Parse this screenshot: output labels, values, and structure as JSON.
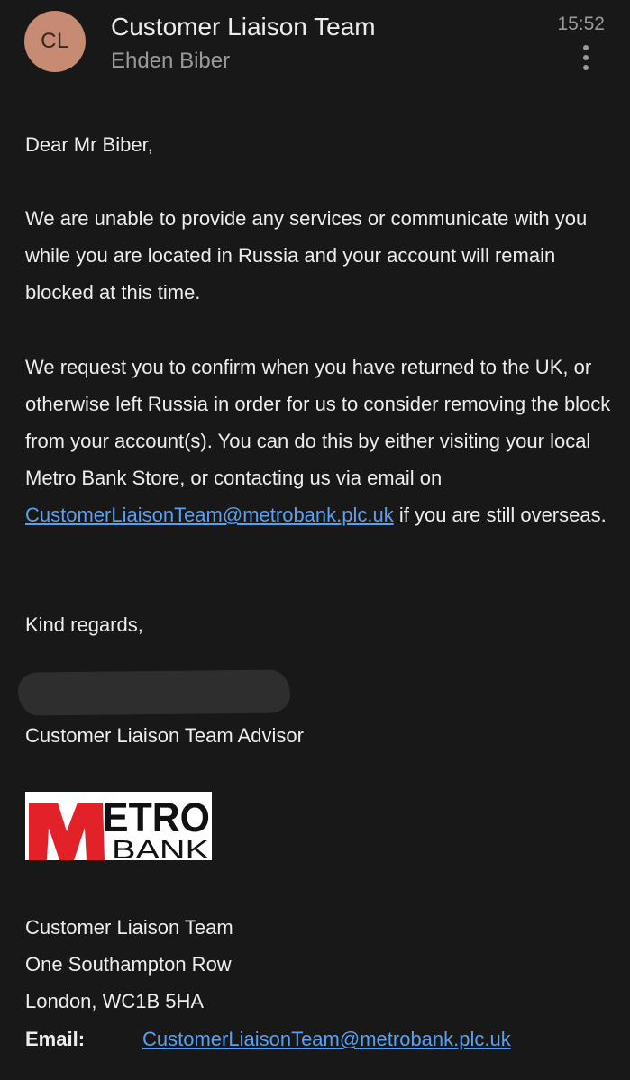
{
  "header": {
    "avatar_initials": "CL",
    "sender_name": "Customer Liaison Team",
    "recipient_name": "Ehden Biber",
    "time": "15:52",
    "more_icon": "more-vertical-icon"
  },
  "message": {
    "greeting": "Dear Mr Biber,",
    "paragraph1": "We are unable to provide any services or communicate with you while you are located in Russia and your account will remain blocked at this time.",
    "paragraph2_before_link": "We request you to confirm when you have returned to the UK, or otherwise left Russia in order for us to consider removing the block from your account(s). You can do this by either visiting your local Metro Bank Store, or contacting us via email on ",
    "paragraph2_link": "CustomerLiaisonTeam@metrobank.plc.uk",
    "paragraph2_after_link": " if you are still overseas.",
    "closing": "Kind regards,",
    "advisor_title": "Customer Liaison Team Advisor"
  },
  "signature": {
    "logo_text_top": "ETRO",
    "logo_text_bottom": "BANK",
    "team_name": "Customer Liaison Team",
    "address_line1": "One Southampton Row",
    "address_line2": "London, WC1B 5HA",
    "email_label": "Email:",
    "email_value": "CustomerLiaisonTeam@metrobank.plc.uk"
  },
  "colors": {
    "background": "#181818",
    "link": "#5a9ff0",
    "avatar": "#c78a72",
    "logo_red": "#e32129"
  }
}
